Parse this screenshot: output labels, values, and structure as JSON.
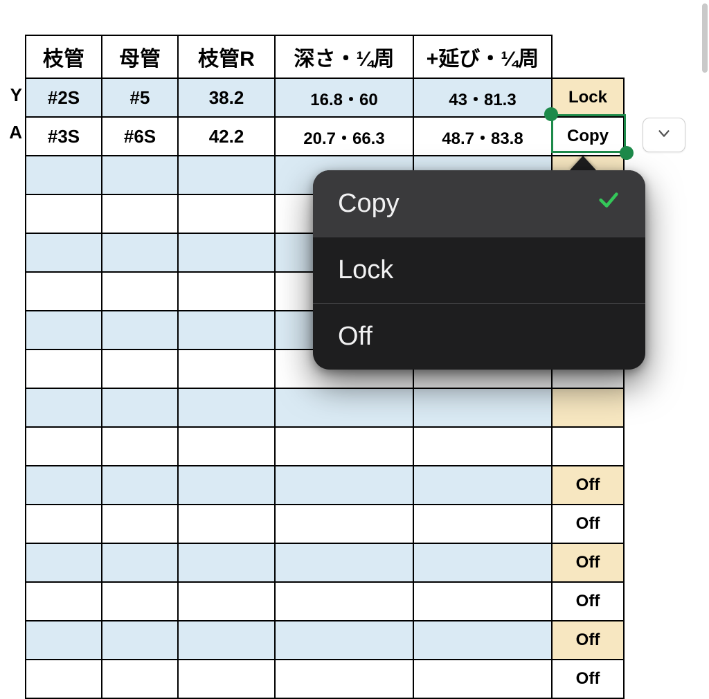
{
  "row_labels": {
    "r1": "Y",
    "r2": "A"
  },
  "table": {
    "headers": [
      "枝管",
      "母管",
      "枝管R",
      "深さ・¼周",
      "+延び・¼周"
    ],
    "rows": [
      {
        "stripe": "even",
        "c1": "#2S",
        "c2": "#5",
        "c3": "38.2",
        "c4": "16.8・60",
        "c5": "43・81.3",
        "state": "Lock"
      },
      {
        "stripe": "odd",
        "c1": "#3S",
        "c2": "#6S",
        "c3": "42.2",
        "c4": "20.7・66.3",
        "c5": "48.7・83.8",
        "state": "Copy"
      },
      {
        "stripe": "even",
        "c1": "",
        "c2": "",
        "c3": "",
        "c4": "",
        "c5": "",
        "state": ""
      },
      {
        "stripe": "odd",
        "c1": "",
        "c2": "",
        "c3": "",
        "c4": "",
        "c5": "",
        "state": ""
      },
      {
        "stripe": "even",
        "c1": "",
        "c2": "",
        "c3": "",
        "c4": "",
        "c5": "",
        "state": ""
      },
      {
        "stripe": "odd",
        "c1": "",
        "c2": "",
        "c3": "",
        "c4": "",
        "c5": "",
        "state": ""
      },
      {
        "stripe": "even",
        "c1": "",
        "c2": "",
        "c3": "",
        "c4": "",
        "c5": "",
        "state": ""
      },
      {
        "stripe": "odd",
        "c1": "",
        "c2": "",
        "c3": "",
        "c4": "",
        "c5": "",
        "state": ""
      },
      {
        "stripe": "even",
        "c1": "",
        "c2": "",
        "c3": "",
        "c4": "",
        "c5": "",
        "state": ""
      },
      {
        "stripe": "odd",
        "c1": "",
        "c2": "",
        "c3": "",
        "c4": "",
        "c5": "",
        "state": ""
      },
      {
        "stripe": "even",
        "c1": "",
        "c2": "",
        "c3": "",
        "c4": "",
        "c5": "",
        "state": "Off"
      },
      {
        "stripe": "odd",
        "c1": "",
        "c2": "",
        "c3": "",
        "c4": "",
        "c5": "",
        "state": "Off"
      },
      {
        "stripe": "even",
        "c1": "",
        "c2": "",
        "c3": "",
        "c4": "",
        "c5": "",
        "state": "Off"
      },
      {
        "stripe": "odd",
        "c1": "",
        "c2": "",
        "c3": "",
        "c4": "",
        "c5": "",
        "state": "Off"
      },
      {
        "stripe": "even",
        "c1": "",
        "c2": "",
        "c3": "",
        "c4": "",
        "c5": "",
        "state": "Off"
      },
      {
        "stripe": "odd",
        "c1": "",
        "c2": "",
        "c3": "",
        "c4": "",
        "c5": "",
        "state": "Off"
      }
    ]
  },
  "dropdown": {
    "options": [
      "Copy",
      "Lock",
      "Off"
    ],
    "selected": "Copy"
  },
  "colors": {
    "row_even_bg": "#daeaf4",
    "row_odd_bg": "#ffffff",
    "state_even_bg": "#f7e7c1",
    "selection_green": "#1d8a4a",
    "popover_bg": "#1e1e1f",
    "popover_sel_bg": "#3a3a3c",
    "check_green": "#34c759"
  }
}
